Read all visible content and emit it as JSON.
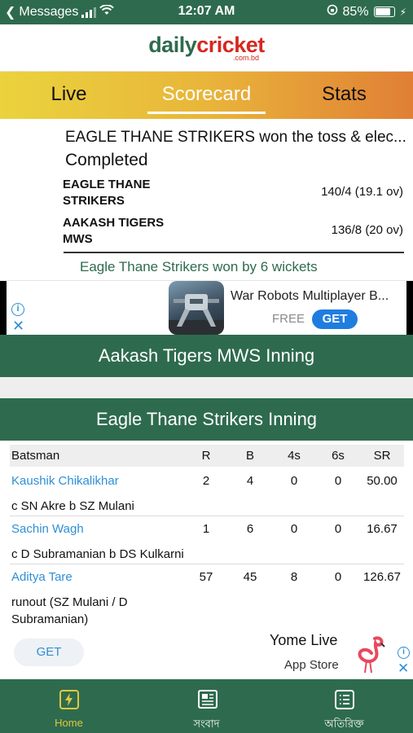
{
  "status_bar": {
    "back_app": "Messages",
    "time": "12:07 AM",
    "battery": "85%",
    "battery_level": 0.85
  },
  "header": {
    "logo_part1": "daily",
    "logo_part2": "cricket",
    "logo_sub": ".com.bd"
  },
  "tabs": [
    {
      "label": "Live",
      "active": false
    },
    {
      "label": "Scorecard",
      "active": true
    },
    {
      "label": "Stats",
      "active": false
    }
  ],
  "match": {
    "toss": "EAGLE THANE STRIKERS won the toss & elec...",
    "status": "Completed",
    "teams": [
      {
        "name": "EAGLE THANE STRIKERS",
        "score": "140/4 (19.1 ov)"
      },
      {
        "name": "AAKASH TIGERS MWS",
        "score": "136/8 (20 ov)"
      }
    ],
    "result": "Eagle Thane Strikers won by 6 wickets"
  },
  "ad_banner": {
    "title": "War Robots Multiplayer B...",
    "price": "FREE",
    "cta": "GET"
  },
  "innings": [
    {
      "title": "Aakash Tigers MWS Inning"
    },
    {
      "title": "Eagle Thane Strikers Inning"
    }
  ],
  "batting": {
    "headers": {
      "batsman": "Batsman",
      "r": "R",
      "b": "B",
      "fours": "4s",
      "sixes": "6s",
      "sr": "SR"
    },
    "rows": [
      {
        "name": "Kaushik Chikalikhar",
        "dismissal": "c SN Akre b SZ Mulani",
        "r": "2",
        "b": "4",
        "fours": "0",
        "sixes": "0",
        "sr": "50.00"
      },
      {
        "name": "Sachin Wagh",
        "dismissal": "c D Subramanian b DS Kulkarni",
        "r": "1",
        "b": "6",
        "fours": "0",
        "sixes": "0",
        "sr": "16.67"
      },
      {
        "name": "Aditya Tare",
        "dismissal": "runout (SZ Mulani / D Subramanian)",
        "r": "57",
        "b": "45",
        "fours": "8",
        "sixes": "0",
        "sr": "126.67"
      }
    ]
  },
  "bottom_ad": {
    "cta": "GET",
    "title": "Yome Live",
    "store": "App Store"
  },
  "bottom_nav": [
    {
      "label": "Home",
      "icon": "bolt-icon",
      "active": true
    },
    {
      "label": "সংবাদ",
      "icon": "newspaper-icon",
      "active": false
    },
    {
      "label": "অতিরিক্ত",
      "icon": "list-icon",
      "active": false
    }
  ],
  "colors": {
    "brand_green": "#2e6b4e",
    "logo_red": "#d6281f",
    "link_blue": "#2f8fd6",
    "nav_active": "#e2c73e"
  }
}
